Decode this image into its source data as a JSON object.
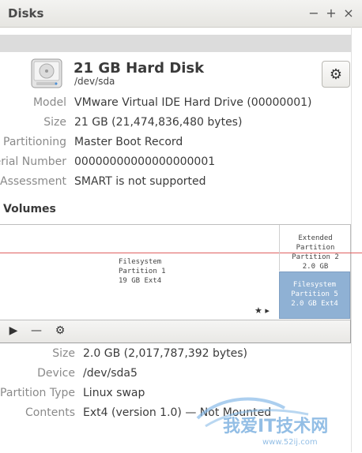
{
  "window": {
    "title": "Disks",
    "minimize_label": "−",
    "maximize_label": "+",
    "close_label": "×"
  },
  "disk": {
    "name": "21 GB Hard Disk",
    "device": "/dev/sda",
    "settings_icon": "gear-icon",
    "info": {
      "model_label": "Model",
      "model_value": "VMware Virtual IDE Hard Drive (00000001)",
      "size_label": "Size",
      "size_value": "21 GB (21,474,836,480 bytes)",
      "partitioning_label": "Partitioning",
      "partitioning_value": "Master Boot Record",
      "serial_label": "Serial Number",
      "serial_value": "00000000000000000001",
      "assessment_label": "Assessment",
      "assessment_value": "SMART is not supported"
    }
  },
  "volumes": {
    "title": "Volumes",
    "filesystem": [
      "Filesystem",
      "Partition 1",
      "19 GB Ext4"
    ],
    "extended": [
      "Extended Partition",
      "Partition 2",
      "2.0 GB"
    ],
    "selected": [
      "Filesystem",
      "Partition 5",
      "2.0 GB Ext4"
    ],
    "marks": "★ ▸",
    "toolbar": {
      "play_label": "▶",
      "minus_label": "—",
      "gear_label": "⚙"
    }
  },
  "details": {
    "size_label": "Size",
    "size_value": "2.0 GB (2,017,787,392 bytes)",
    "device_label": "Device",
    "device_value": "/dev/sda5",
    "partition_type_label": "Partition Type",
    "partition_type_value": "Linux swap",
    "contents_label": "Contents",
    "contents_value": "Ext4 (version 1.0) — Not Mounted"
  },
  "watermark": {
    "text": "我爱IT技术网",
    "url": "www.52ij.com"
  }
}
